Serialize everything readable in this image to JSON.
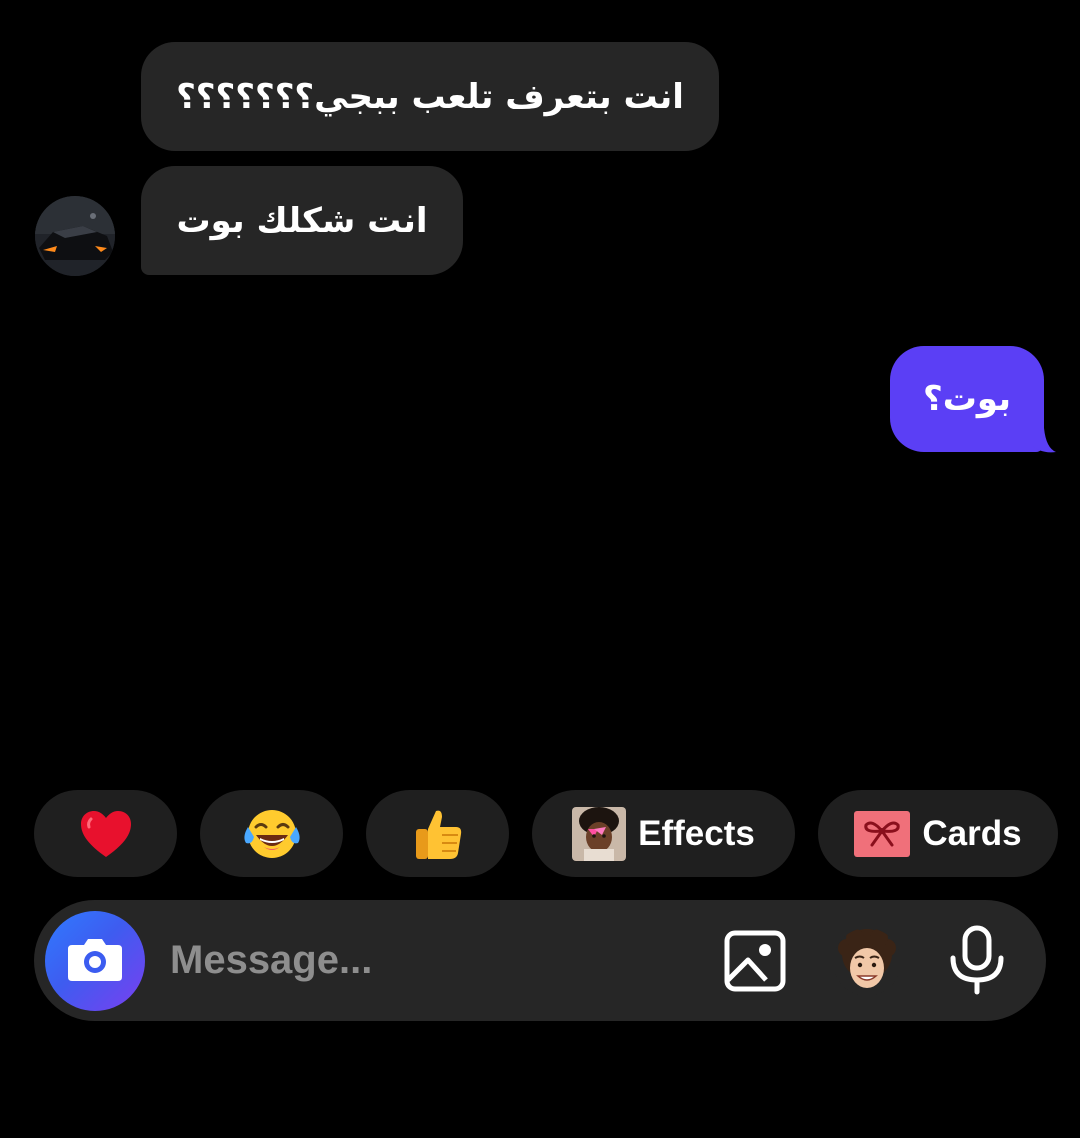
{
  "conversation": {
    "messages": [
      {
        "direction": "incoming",
        "text": "انت بتعرف تلعب ببجي؟؟؟؟؟؟؟"
      },
      {
        "direction": "incoming",
        "text": "انت شكلك بوت"
      },
      {
        "direction": "outgoing",
        "text": "بوت؟"
      }
    ],
    "contact_avatar": "car-avatar"
  },
  "quick_replies": {
    "heart": "heart-emoji",
    "laugh": "tears-of-joy-emoji",
    "thumb": "thumbs-up-emoji",
    "effects_label": "Effects",
    "cards_label": "Cards"
  },
  "composer": {
    "placeholder": "Message...",
    "camera_icon": "camera-icon",
    "gallery_icon": "image-icon",
    "avatar_icon": "avatar-sticker",
    "mic_icon": "microphone-icon"
  },
  "colors": {
    "background": "#000000",
    "incoming_bubble": "#262626",
    "outgoing_bubble": "#5b3ff5",
    "chip_background": "#1f1f1f",
    "composer_background": "#262626",
    "placeholder_text": "#8e8e8e"
  }
}
